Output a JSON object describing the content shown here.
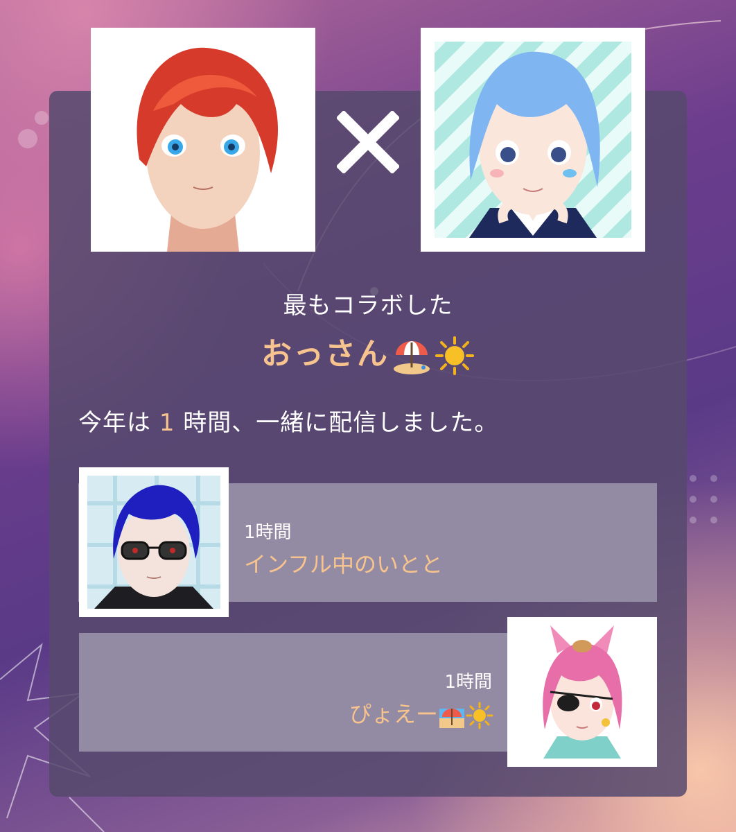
{
  "header": {
    "left_avatar_icon": "red-haired-avatar",
    "right_avatar_icon": "blue-haired-avatar",
    "cross_icon": "cross-icon"
  },
  "headline": {
    "subtitle": "最もコラボした",
    "top_name": "おっさん",
    "top_name_emojis": [
      "beach-umbrella-icon",
      "sun-icon"
    ]
  },
  "summary": {
    "prefix": "今年は",
    "hours": "1",
    "suffix": "時間、一緒に配信しました。"
  },
  "collaborators": [
    {
      "hours_label": "1時間",
      "name": "インフル中のいとと",
      "avatar_icon": "blue-hair-sunglasses-avatar",
      "align": "left"
    },
    {
      "hours_label": "1時間",
      "name": "ぴょえー",
      "name_emojis": [
        "beach-umbrella-icon",
        "sun-icon"
      ],
      "avatar_icon": "pink-hair-eyepatch-avatar",
      "align": "right"
    }
  ],
  "colors": {
    "accent": "#f7c38e",
    "card_bg": "#56496e",
    "row_bg": "#938aa3",
    "text": "#ffffff"
  }
}
